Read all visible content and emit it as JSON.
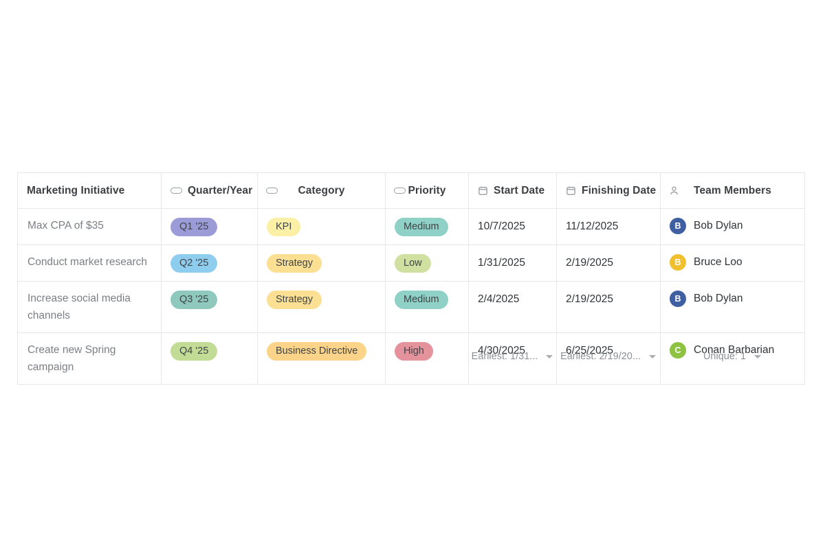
{
  "table": {
    "columns": [
      {
        "key": "initiative",
        "label": "Marketing Initiative",
        "icon": "none",
        "align": "left"
      },
      {
        "key": "quarter",
        "label": "Quarter/Year",
        "icon": "pill-icon",
        "align": "center"
      },
      {
        "key": "category",
        "label": "Category",
        "icon": "pill-icon",
        "align": "center"
      },
      {
        "key": "priority",
        "label": "Priority",
        "icon": "pill-icon",
        "align": "center"
      },
      {
        "key": "start",
        "label": "Start Date",
        "icon": "calendar-icon",
        "align": "left"
      },
      {
        "key": "finish",
        "label": "Finishing Date",
        "icon": "calendar-icon",
        "align": "left"
      },
      {
        "key": "members",
        "label": "Team Members",
        "icon": "person-icon",
        "align": "center"
      }
    ],
    "rows": [
      {
        "initiative": "Max CPA of $35",
        "quarter": "Q1 '25",
        "quarter_color": "#9b9bd8",
        "category": "KPI",
        "category_color": "#fbf0a6",
        "priority": "Medium",
        "priority_color": "#8fd1c6",
        "start": "10/7/2025",
        "finish": "11/12/2025",
        "member": "Bob Dylan",
        "member_initial": "B",
        "member_color": "#3f5fa3"
      },
      {
        "initiative": "Conduct market research",
        "quarter": "Q2 '25",
        "quarter_color": "#8fcdef",
        "category": "Strategy",
        "category_color": "#fbdf93",
        "priority": "Low",
        "priority_color": "#cfe0a0",
        "start": "1/31/2025",
        "finish": "2/19/2025",
        "member": "Bruce Loo",
        "member_initial": "B",
        "member_color": "#f1c02f"
      },
      {
        "initiative": "Increase social media channels",
        "quarter": "Q3 '25",
        "quarter_color": "#8fc9bd",
        "category": "Strategy",
        "category_color": "#fbdf93",
        "priority": "Medium",
        "priority_color": "#8fd1c6",
        "start": "2/4/2025",
        "finish": "2/19/2025",
        "member": "Bob Dylan",
        "member_initial": "B",
        "member_color": "#3f5fa3"
      },
      {
        "initiative": "Create new Spring campaign",
        "quarter": "Q4 '25",
        "quarter_color": "#c2dc96",
        "category": "Business Directive",
        "category_color": "#fcd489",
        "priority": "High",
        "priority_color": "#e4929c",
        "start": "4/30/2025",
        "finish": "6/25/2025",
        "member": "Conan Barbarian",
        "member_initial": "C",
        "member_color": "#8ec341"
      }
    ],
    "summaries": [
      {
        "column": "start",
        "label": "Earliest: 1/31..."
      },
      {
        "column": "finish",
        "label": "Earliest: 2/19/20..."
      },
      {
        "column": "members",
        "label": "Unique: 1"
      }
    ]
  },
  "colors": {
    "border": "#e6e7e9",
    "header_bg": "#fbfbfc",
    "header_text": "#3c4043",
    "body_text": "#2f3336",
    "muted_text": "#8c9196",
    "link_text": "#7b7f85"
  }
}
